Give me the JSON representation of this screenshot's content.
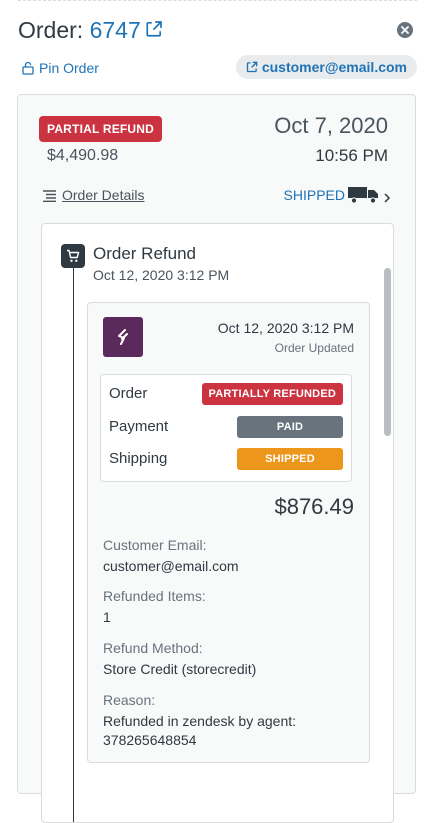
{
  "header": {
    "title_prefix": "Order:",
    "order_number": "6747",
    "pin_label": "Pin Order",
    "customer_email": "customer@email.com"
  },
  "summary": {
    "status_badge": "PARTIAL REFUND",
    "total": "$4,490.98",
    "date": "Oct 7, 2020",
    "time": "10:56 PM",
    "details_link": "Order Details",
    "shipping_status": "SHIPPED"
  },
  "event": {
    "title": "Order Refund",
    "date": "Oct 12, 2020 3:12 PM",
    "card": {
      "date": "Oct 12, 2020 3:12 PM",
      "subtitle": "Order Updated",
      "statuses": [
        {
          "label": "Order",
          "value": "PARTIALLY REFUNDED",
          "color": "#cc3340"
        },
        {
          "label": "Payment",
          "value": "PAID",
          "color": "#68737d"
        },
        {
          "label": "Shipping",
          "value": "SHIPPED",
          "color": "#ed961c"
        }
      ],
      "amount": "$876.49",
      "fields": [
        {
          "label": "Customer Email:",
          "value": "customer@email.com"
        },
        {
          "label": "Refunded Items:",
          "value": "1"
        },
        {
          "label": "Refund Method:",
          "value": "Store Credit (storecredit)"
        },
        {
          "label": "Reason:",
          "value": "Refunded in zendesk by agent: 378265648854"
        }
      ]
    }
  },
  "icons": {
    "external_link": "external-link-icon",
    "close": "close-icon",
    "pin": "lock-icon",
    "list": "list-icon",
    "truck": "truck-icon",
    "chevron": "chevron-right-icon",
    "cart": "cart-icon",
    "logo": "app-logo"
  },
  "colors": {
    "link": "#1f73b7",
    "danger": "#cc3340",
    "warning": "#ed961c",
    "neutral": "#68737d"
  }
}
